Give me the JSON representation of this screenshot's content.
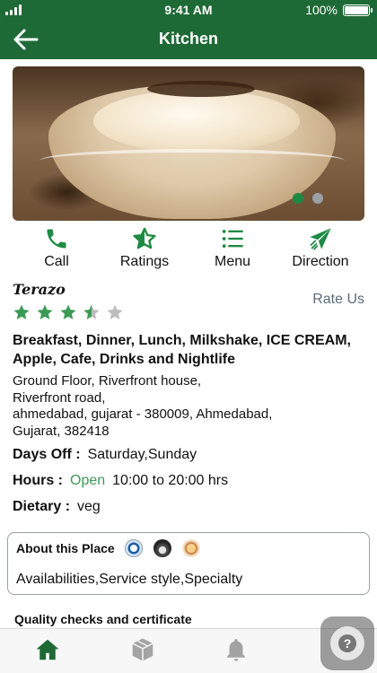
{
  "status_bar": {
    "time": "9:41 AM",
    "battery": "100%"
  },
  "nav": {
    "title": "Kitchen",
    "back_icon": "arrow-left-icon"
  },
  "hero": {
    "slides": 2,
    "active_slide": 1
  },
  "actions": [
    {
      "label": "Call",
      "icon": "phone-icon"
    },
    {
      "label": "Ratings",
      "icon": "star-half-icon"
    },
    {
      "label": "Menu",
      "icon": "list-icon"
    },
    {
      "label": "Direction",
      "icon": "send-icon"
    }
  ],
  "place": {
    "name": "Terazo",
    "rate_us": "Rate Us",
    "rating": 3.5,
    "rating_max": 5,
    "categories": "Breakfast, Dinner, Lunch, Milkshake, ICE CREAM, Apple, Cafe, Drinks and Nightlife",
    "address_lines": [
      "Ground Floor, Riverfront house,",
      "Riverfront road,",
      "ahmedabad, gujarat - 380009, Ahmedabad,",
      "Gujarat, 382418"
    ]
  },
  "details": {
    "days_off_label": "Days Off :",
    "days_off_value": "Saturday,Sunday",
    "hours_label": "Hours :",
    "hours_status": "Open",
    "hours_value": "10:00 to 20:00 hrs",
    "dietary_label": "Dietary :",
    "dietary_value": "veg"
  },
  "about": {
    "title": "About this Place",
    "content": "Availabilities,Service style,Specialty"
  },
  "quality": {
    "title": "Quality checks and certificate"
  },
  "tab_bar": [
    {
      "icon": "home-icon",
      "active": true
    },
    {
      "icon": "box-icon",
      "active": false
    },
    {
      "icon": "bell-icon",
      "active": false
    }
  ],
  "colors": {
    "primary": "#1e6a36",
    "accent": "#3d9a56",
    "inactive": "#9a9a9a"
  }
}
